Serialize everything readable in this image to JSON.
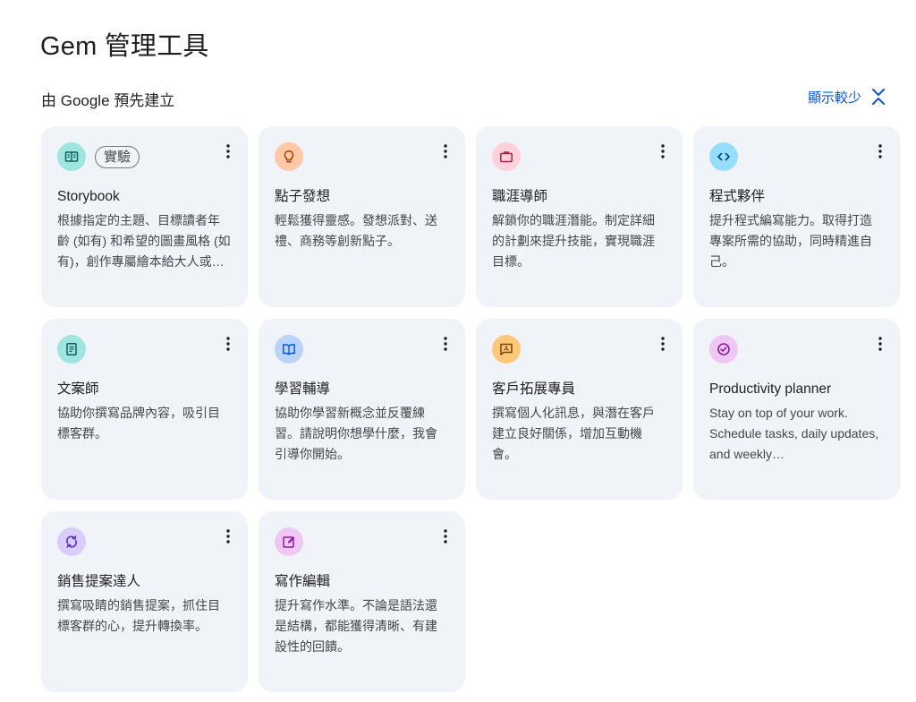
{
  "header": {
    "title": "Gem 管理工具"
  },
  "section": {
    "title": "由 Google 預先建立",
    "toggle_label": "顯示較少"
  },
  "colors": {
    "accent": "#0b57d0",
    "card_bg": "#f0f4f9"
  },
  "cards": [
    {
      "title": "Storybook",
      "badge": "實驗",
      "icon": "book-icon",
      "icon_bg": "#9ee5e0",
      "icon_fg": "#0b5e5a",
      "desc": "根據指定的主題、目標讀者年齡 (如有) 和希望的圖畫風格 (如有)，創作專屬繪本給大人或…"
    },
    {
      "title": "點子發想",
      "icon": "lightbulb-icon",
      "icon_bg": "#ffc9a9",
      "icon_fg": "#a14200",
      "desc": "輕鬆獲得靈感。發想派對、送禮、商務等創新點子。"
    },
    {
      "title": "職涯導師",
      "icon": "briefcase-icon",
      "icon_bg": "#ffd1db",
      "icon_fg": "#a3224a",
      "desc": "解鎖你的職涯潛能。制定詳細的計劃來提升技能，實現職涯目標。"
    },
    {
      "title": "程式夥伴",
      "icon": "code-icon",
      "icon_bg": "#97defc",
      "icon_fg": "#004a77",
      "desc": "提升程式編寫能力。取得打造專案所需的協助，同時精進自己。"
    },
    {
      "title": "文案師",
      "icon": "document-icon",
      "icon_bg": "#9ee5e0",
      "icon_fg": "#0b5e5a",
      "desc": "協助你撰寫品牌內容，吸引目標客群。"
    },
    {
      "title": "學習輔導",
      "icon": "open-book-icon",
      "icon_bg": "#b9d3fb",
      "icon_fg": "#0b57d0",
      "desc": "協助你學習新概念並反覆練習。請說明你想學什麼，我會引導你開始。"
    },
    {
      "title": "客戶拓展專員",
      "icon": "message-icon",
      "icon_bg": "#ffc77a",
      "icon_fg": "#7a4400",
      "desc": "撰寫個人化訊息，與潛在客戶建立良好關係，增加互動機會。"
    },
    {
      "title": "Productivity planner",
      "icon": "check-circle-icon",
      "icon_bg": "#f0c6f5",
      "icon_fg": "#8a1a9b",
      "desc": "Stay on top of your work. Schedule tasks, daily updates, and weekly…"
    },
    {
      "title": "銷售提案達人",
      "icon": "sync-icon",
      "icon_bg": "#d9ccff",
      "icon_fg": "#5b2fc8",
      "desc": "撰寫吸睛的銷售提案，抓住目標客群的心，提升轉換率。"
    },
    {
      "title": "寫作編輯",
      "icon": "edit-icon",
      "icon_bg": "#f0c6f5",
      "icon_fg": "#8a1a9b",
      "desc": "提升寫作水準。不論是語法還是結構，都能獲得清晰、有建設性的回饋。"
    }
  ]
}
